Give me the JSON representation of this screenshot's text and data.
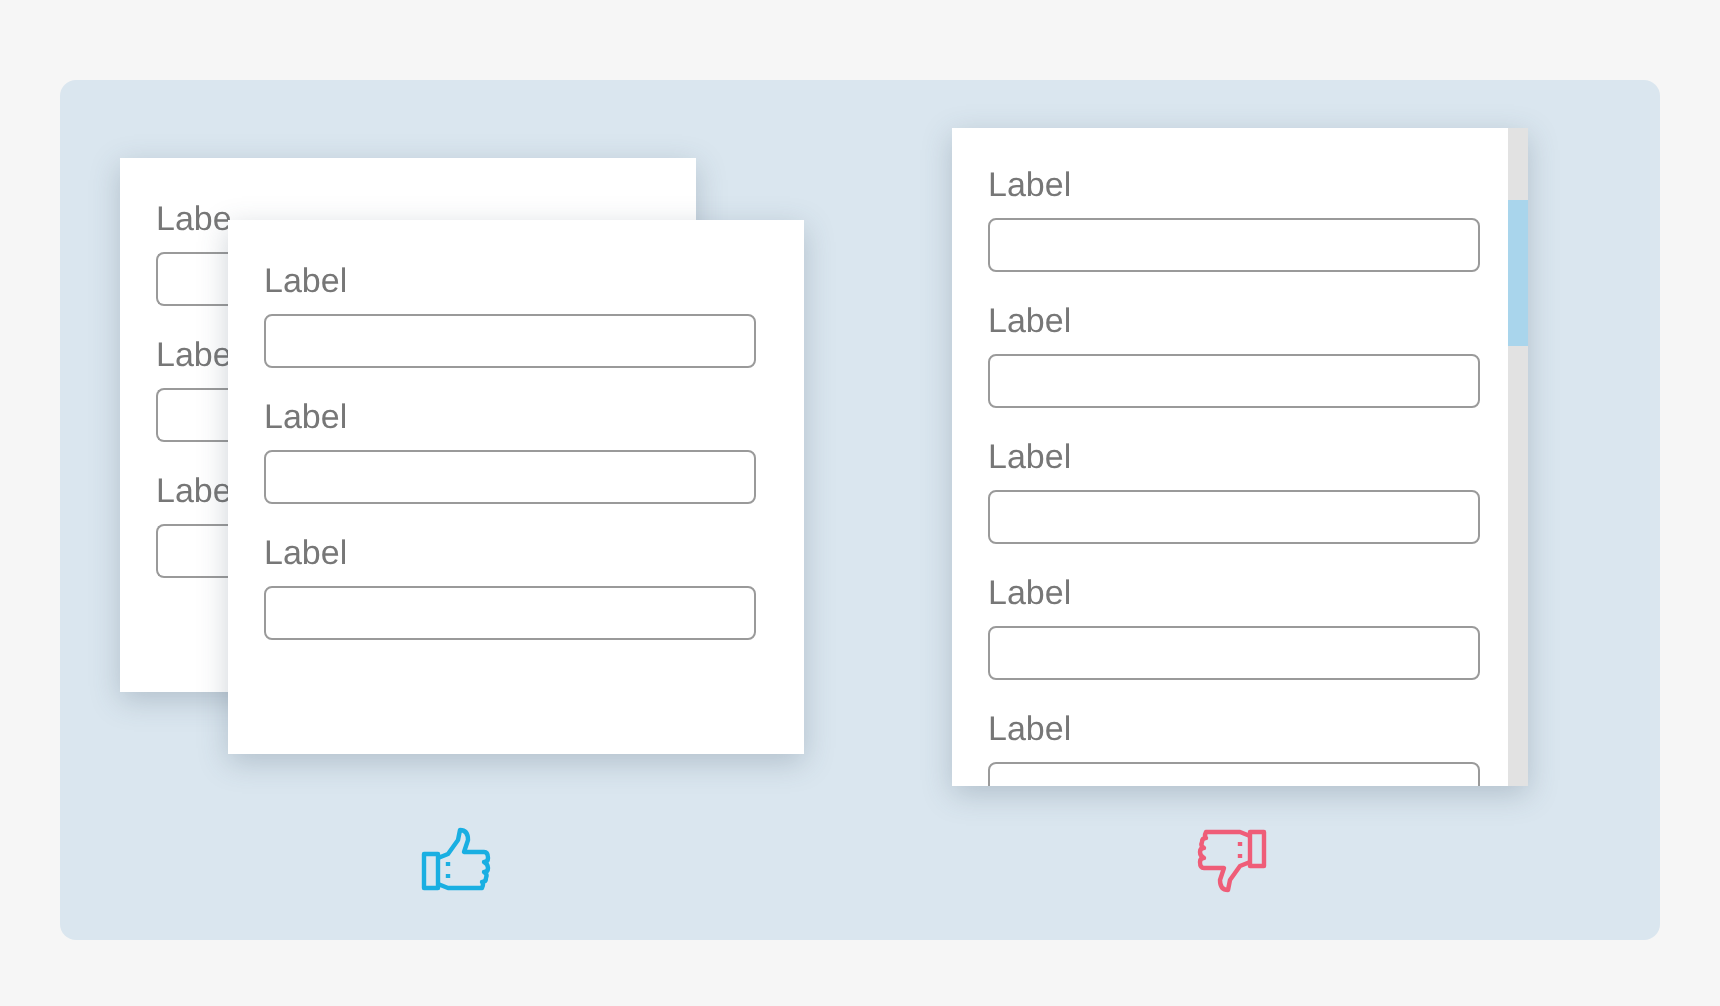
{
  "examples": [
    {
      "kind": "good",
      "cards": [
        {
          "kind": "back",
          "fields": [
            {
              "label": "Labe"
            },
            {
              "label": "Labe"
            },
            {
              "label": "Labe"
            }
          ]
        },
        {
          "kind": "front",
          "fields": [
            {
              "label": "Label"
            },
            {
              "label": "Label"
            },
            {
              "label": "Label"
            }
          ]
        }
      ]
    },
    {
      "kind": "bad",
      "cards": [
        {
          "kind": "scrolling",
          "fields": [
            {
              "label": "Label"
            },
            {
              "label": "Label"
            },
            {
              "label": "Label"
            },
            {
              "label": "Label"
            },
            {
              "label": "Label"
            }
          ]
        }
      ]
    }
  ]
}
